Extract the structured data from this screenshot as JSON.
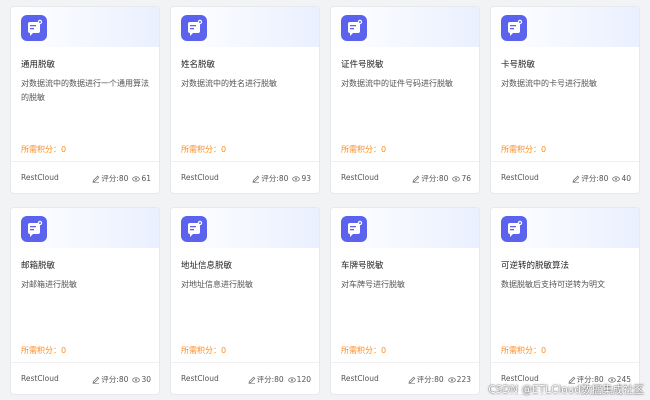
{
  "theme": {
    "accent": "#5b63ee",
    "points_color": "#ff8a1f",
    "background": "#f2f3f5"
  },
  "cards": [
    {
      "icon": "document-chat-icon",
      "title": "通用脱敏",
      "description": "对数据流中的数据进行一个通用算法的脱敏",
      "points_label": "所需积分：0",
      "vendor": "RestCloud",
      "rating": "评分:80",
      "views": "61"
    },
    {
      "icon": "document-chat-icon",
      "title": "姓名脱敏",
      "description": "对数据流中的姓名进行脱敏",
      "points_label": "所需积分：0",
      "vendor": "RestCloud",
      "rating": "评分:80",
      "views": "93"
    },
    {
      "icon": "document-chat-icon",
      "title": "证件号脱敏",
      "description": "对数据流中的证件号码进行脱敏",
      "points_label": "所需积分：0",
      "vendor": "RestCloud",
      "rating": "评分:80",
      "views": "76"
    },
    {
      "icon": "document-chat-icon",
      "title": "卡号脱敏",
      "description": "对数据流中的卡号进行脱敏",
      "points_label": "所需积分：0",
      "vendor": "RestCloud",
      "rating": "评分:80",
      "views": "40"
    },
    {
      "icon": "document-chat-icon",
      "title": "邮箱脱敏",
      "description": "对邮箱进行脱敏",
      "points_label": "所需积分：0",
      "vendor": "RestCloud",
      "rating": "评分:80",
      "views": "30"
    },
    {
      "icon": "document-chat-icon",
      "title": "地址信息脱敏",
      "description": "对地址信息进行脱敏",
      "points_label": "所需积分：0",
      "vendor": "RestCloud",
      "rating": "评分:80",
      "views": "120"
    },
    {
      "icon": "document-chat-icon",
      "title": "车牌号脱敏",
      "description": "对车牌号进行脱敏",
      "points_label": "所需积分：0",
      "vendor": "RestCloud",
      "rating": "评分:80",
      "views": "223"
    },
    {
      "icon": "document-chat-icon",
      "title": "可逆转的脱敏算法",
      "description": "数据脱敏后支持可逆转为明文",
      "points_label": "所需积分：0",
      "vendor": "RestCloud",
      "rating": "评分:80",
      "views": "245"
    }
  ],
  "watermark": "CSDN @ETLCloud数据集成社区"
}
